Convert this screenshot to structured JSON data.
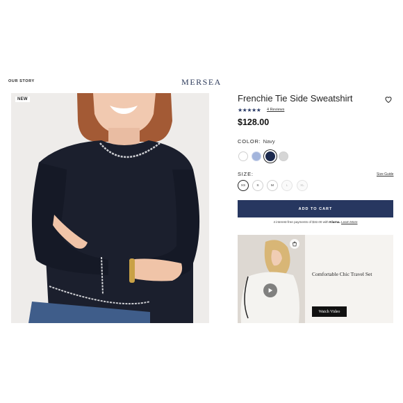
{
  "header": {
    "nav_link": "OUR STORY",
    "logo": "MERSEA"
  },
  "gallery": {
    "badge": "NEW"
  },
  "product": {
    "title": "Frenchie Tie Side Sweatshirt",
    "rating": 5,
    "stars": "★★★★★",
    "reviews": "4 Reviews",
    "price": "$128.00",
    "color_label": "COLOR:",
    "color_value": "Navy",
    "swatches": [
      {
        "name": "White",
        "color": "#ffffff"
      },
      {
        "name": "Light Blue",
        "color": "#a3b5dc"
      },
      {
        "name": "Navy",
        "color": "#1c2a4e",
        "selected": true
      },
      {
        "name": "Grey",
        "color": "#d6d6d6"
      }
    ],
    "size_label": "SIZE:",
    "size_guide": "Size Guide",
    "sizes": [
      {
        "label": "XS",
        "state": "selected"
      },
      {
        "label": "S",
        "state": "available"
      },
      {
        "label": "M",
        "state": "available"
      },
      {
        "label": "L",
        "state": "unavailable"
      },
      {
        "label": "XL",
        "state": "unavailable"
      }
    ],
    "add_to_cart": "ADD TO CART",
    "klarna": {
      "prefix": "4 interest-free payments of $32.00 with",
      "brand": "Klarna.",
      "link": "Learn More"
    }
  },
  "promo": {
    "title": "Comfortable Chic Travel Set",
    "button": "Watch Video"
  },
  "icons": {
    "favorite": "heart-icon",
    "play": "play-icon",
    "shop": "shopping-bag-icon"
  },
  "colors": {
    "brand_navy": "#273760",
    "star": "#2a3a66"
  }
}
